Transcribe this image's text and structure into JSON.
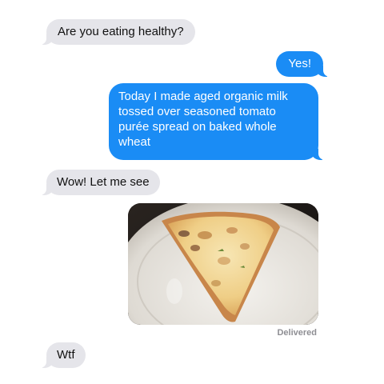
{
  "messages": [
    {
      "sender": "them",
      "text": "Are you eating healthy?"
    },
    {
      "sender": "me",
      "text": "Yes!"
    },
    {
      "sender": "me",
      "text": "Today I made aged organic milk tossed over seasoned tomato purée spread on baked whole wheat"
    },
    {
      "sender": "them",
      "text": "Wow! Let me see"
    },
    {
      "sender": "me",
      "type": "photo",
      "photo_subject": "slice of cheese pizza on a white plate"
    },
    {
      "sender": "them",
      "text": "Wtf"
    }
  ],
  "status": "Delivered",
  "colors": {
    "incoming_bubble": "#e5e5ea",
    "outgoing_bubble": "#1a8cf5",
    "incoming_text": "#111111",
    "outgoing_text": "#ffffff",
    "status_text": "#8e8e93"
  }
}
